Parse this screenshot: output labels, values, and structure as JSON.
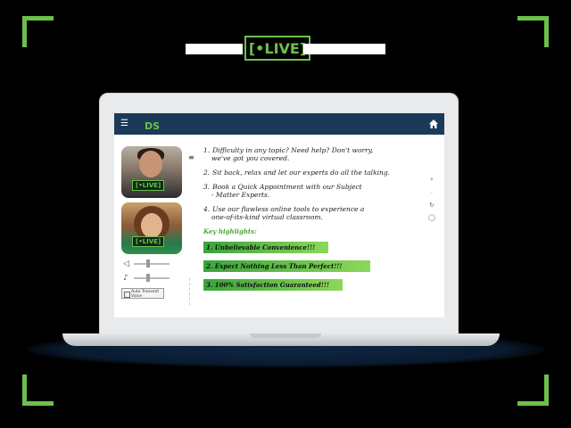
{
  "banner": {
    "live_logo": "[•LIVE]"
  },
  "app": {
    "logo_text": "DS",
    "teacher_badge": "[•LIVE]",
    "student_badge": "[•LIVE]"
  },
  "controls": {
    "auto_transmit_label": "Auto Transmit Voice"
  },
  "content": {
    "points": [
      {
        "num": "1.",
        "line1": "Difficulty in any topic? Need help? Don't worry,",
        "line2": "we've got you covered."
      },
      {
        "num": "2.",
        "line1": "Sit back, relax and let our experts do all the talking.",
        "line2": ""
      },
      {
        "num": "3.",
        "line1": "Book a Quick Appointment with our Subject",
        "line2": "- Matter Experts."
      },
      {
        "num": "4.",
        "line1": "Use our flawless online tools to experience a",
        "line2": "one-of-its-kind virtual classroom."
      }
    ],
    "key_highlights_label": "Key highlights:",
    "highlights": [
      "1. Unbelievable Convenience!!!",
      "2. Expect Nothing Less Than Perfect!!!",
      "3. 100% Satisfaction Guaranteed!!!"
    ]
  },
  "colors": {
    "accent": "#6cc04a",
    "navbar": "#1b3a57"
  }
}
